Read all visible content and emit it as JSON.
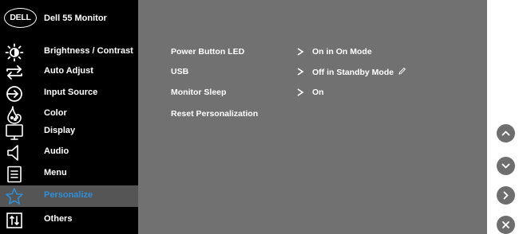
{
  "header": {
    "logo": "DELL",
    "monitor_name": "Dell 55 Monitor"
  },
  "menu": {
    "items": [
      {
        "label": "Brightness / Contrast",
        "icon": "brightness-icon"
      },
      {
        "label": "Auto Adjust",
        "icon": "auto-adjust-icon"
      },
      {
        "label": "Input Source",
        "icon": "input-source-icon"
      },
      {
        "label": "Color",
        "icon": "color-icon"
      },
      {
        "label": "Display",
        "icon": "display-icon"
      },
      {
        "label": "Audio",
        "icon": "audio-icon"
      },
      {
        "label": "Menu",
        "icon": "menu-icon"
      },
      {
        "label": "Personalize",
        "icon": "star-icon",
        "selected": true
      },
      {
        "label": "Others",
        "icon": "others-icon"
      }
    ]
  },
  "options": [
    {
      "label": "Power Button LED",
      "value": "On in On Mode"
    },
    {
      "label": "USB",
      "value": "Off in Standby Mode",
      "value_icon": "pencil-icon"
    },
    {
      "label": "Monitor Sleep",
      "value": "On"
    },
    {
      "label": "Reset Personalization",
      "value": ""
    }
  ],
  "nav_buttons": [
    "chevron-up-icon",
    "chevron-down-icon",
    "chevron-right-icon",
    "close-icon"
  ],
  "colors": {
    "sidebar": "#000000",
    "panel": "#717171",
    "selected_row": "#555555",
    "selected_text": "#2f8fd8",
    "nav_button": "#6e6e6e"
  }
}
